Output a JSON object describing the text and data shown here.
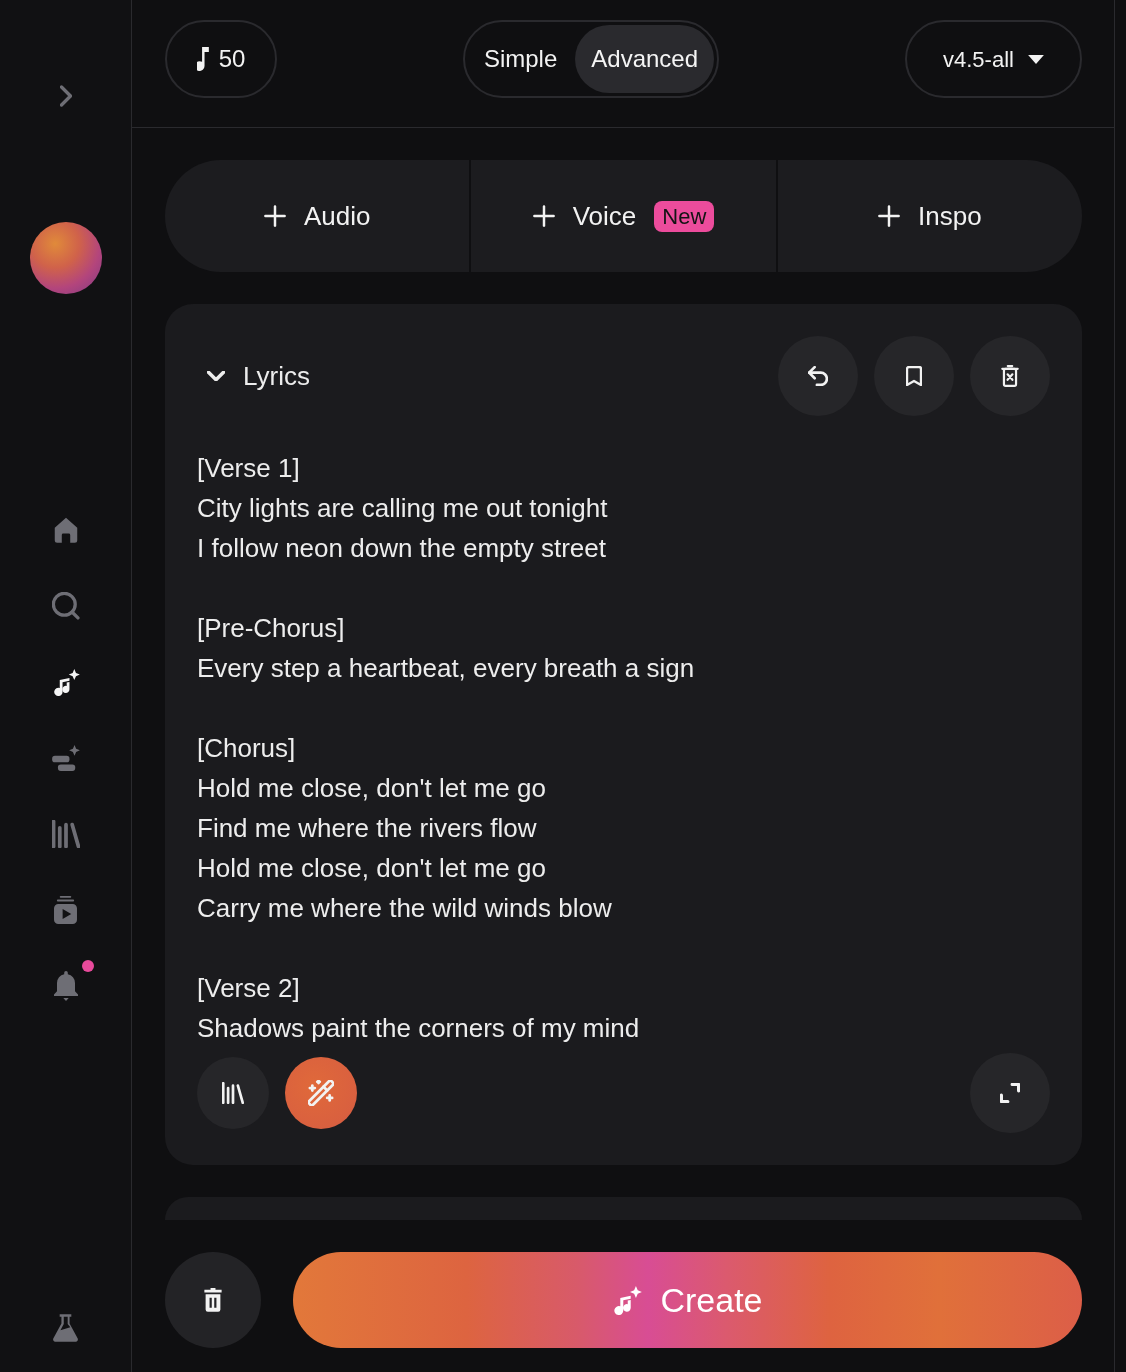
{
  "sidebar": {
    "nav": [
      {
        "selected": false,
        "dot": false
      },
      {
        "selected": false,
        "dot": false
      },
      {
        "selected": true,
        "dot": false
      },
      {
        "selected": false,
        "dot": false
      },
      {
        "selected": false,
        "dot": false
      },
      {
        "selected": false,
        "dot": false
      },
      {
        "selected": false,
        "dot": true
      }
    ]
  },
  "header": {
    "credits": "50",
    "mode_options": [
      {
        "label": "Simple",
        "selected": false
      },
      {
        "label": "Advanced",
        "selected": true
      }
    ],
    "model": "v4.5-all"
  },
  "add_buttons": [
    {
      "label": "Audio"
    },
    {
      "label": "Voice",
      "badge": "New"
    },
    {
      "label": "Inspo"
    }
  ],
  "lyrics_panel": {
    "title": "Lyrics",
    "expanded": true,
    "sections": [
      {
        "heading": "[Verse 1]",
        "lines": [
          "City lights are calling me out tonight",
          "I follow neon down the empty street"
        ]
      },
      {
        "heading": "[Pre-Chorus]",
        "lines": [
          "Every step a heartbeat, every breath a sign"
        ]
      },
      {
        "heading": "[Chorus]",
        "lines": [
          "Hold me close, don't let me go",
          "Find me where the rivers flow",
          "Hold me close, don't let me go",
          "Carry me where the wild winds blow"
        ]
      },
      {
        "heading": "[Verse 2]",
        "lines": [
          "Shadows paint the corners of my mind"
        ]
      }
    ]
  },
  "create_button": {
    "label": "Create"
  }
}
